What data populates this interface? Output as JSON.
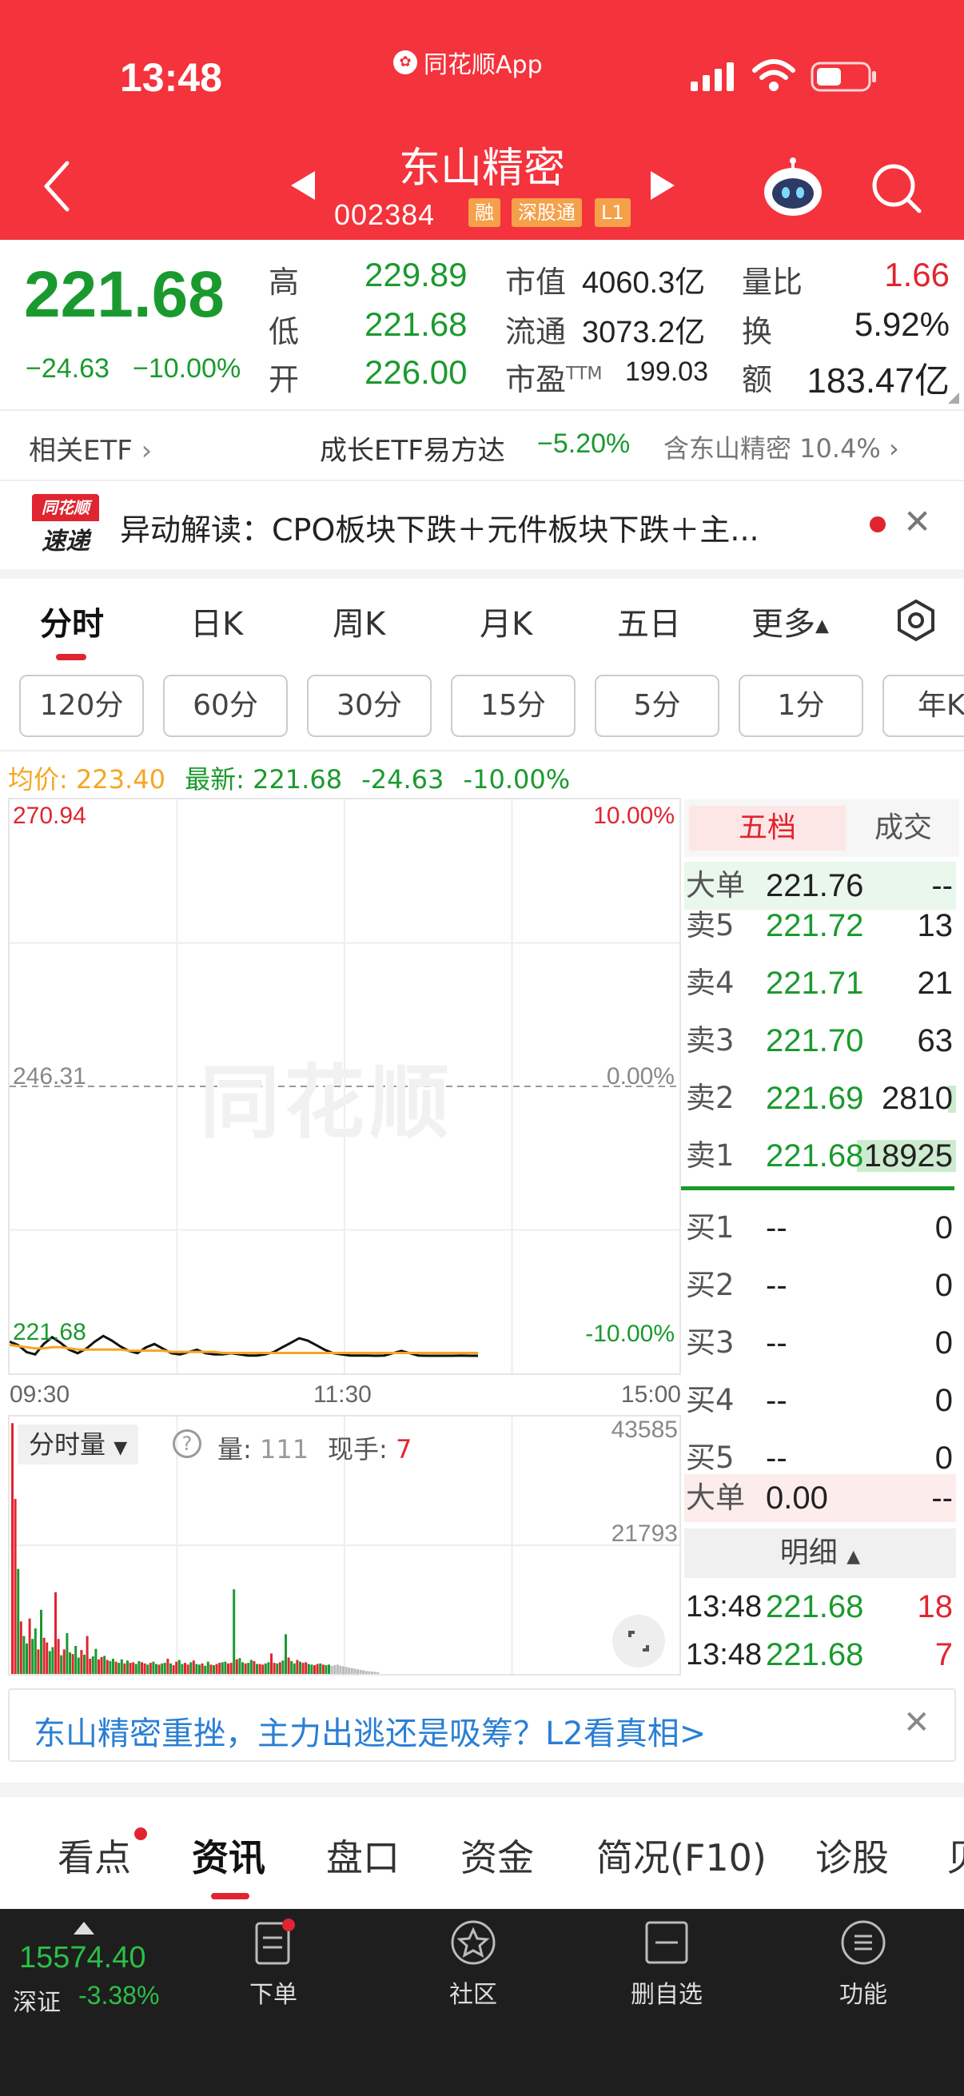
{
  "status_bar": {
    "time": "13:48",
    "app_label": "同花顺App"
  },
  "header": {
    "title": "东山精密",
    "code": "002384",
    "tags": [
      "融",
      "深股通",
      "L1"
    ],
    "icons": [
      "back-icon",
      "prev-stock-icon",
      "next-stock-icon",
      "robot-assistant-icon",
      "search-icon"
    ]
  },
  "quote": {
    "price": "221.68",
    "change": "−24.63",
    "change_pct": "−10.00%",
    "fields": [
      {
        "label": "高",
        "value": "229.89"
      },
      {
        "label": "低",
        "value": "221.68"
      },
      {
        "label": "开",
        "value": "226.00"
      }
    ],
    "fields2": [
      {
        "label": "市值",
        "value": "4060.3亿"
      },
      {
        "label": "流通",
        "value": "3073.2亿"
      },
      {
        "label": "市盈",
        "sup": "TTM",
        "value": "199.03"
      }
    ],
    "fields3": [
      {
        "label": "量比",
        "value": "1.66"
      },
      {
        "label": "换",
        "value": "5.92%"
      },
      {
        "label": "额",
        "value": "183.47亿"
      }
    ]
  },
  "etf": {
    "label": "相关ETF",
    "name": "成长ETF易方达",
    "change": "−5.20%",
    "holding": "含东山精密 10.4%"
  },
  "news_banner": {
    "badge_top": "同花顺",
    "badge_bottom": "速递",
    "text": "异动解读：CPO板块下跌＋元件板块下跌＋主..."
  },
  "chart_tabs": [
    "分时",
    "日K",
    "周K",
    "月K",
    "五日",
    "更多"
  ],
  "period_buttons": [
    "120分",
    "60分",
    "30分",
    "15分",
    "5分",
    "1分",
    "年K"
  ],
  "price_line": {
    "avg_label": "均价:",
    "avg": "223.40",
    "latest_label": "最新:",
    "latest": "221.68",
    "chg": "-24.63",
    "pct": "-10.00%"
  },
  "chart_data": {
    "type": "line",
    "y_top": "270.94",
    "y_mid": "246.31",
    "y_bottom": "221.68",
    "pct_top": "10.00%",
    "pct_mid": "0.00%",
    "pct_bottom": "-10.00%",
    "x_labels": [
      "09:30",
      "11:30",
      "15:00"
    ],
    "watermark": "同花顺",
    "ylim": [
      221.68,
      270.94
    ],
    "series": [
      {
        "values": [
          222.9,
          222.6,
          222.0,
          221.8,
          222.7,
          223.3,
          222.8,
          222.2,
          221.9,
          222.3,
          222.9,
          223.4,
          223.0,
          222.5,
          222.1,
          221.9,
          222.4,
          222.7,
          222.3,
          221.9,
          221.8,
          222.0,
          222.2,
          221.9,
          221.8,
          221.8,
          221.9,
          221.8,
          221.7,
          221.7,
          221.8,
          222.0,
          222.4,
          222.8,
          223.2,
          223.0,
          222.6,
          222.2,
          221.9,
          221.8,
          221.7,
          221.7,
          221.7,
          221.68,
          221.7,
          221.9,
          222.1,
          221.9,
          221.7,
          221.68,
          221.68,
          221.68,
          221.68,
          221.7,
          221.68,
          221.68
        ]
      },
      {
        "values": [
          222.9,
          222.8,
          222.7,
          222.6,
          222.6,
          222.7,
          222.7,
          222.6,
          222.5,
          222.5,
          222.5,
          222.5,
          222.5,
          222.5,
          222.4,
          222.4,
          222.4,
          222.4,
          222.4,
          222.3,
          222.3,
          222.3,
          222.3,
          222.3,
          222.3,
          222.2,
          222.2,
          222.2,
          222.2,
          222.2,
          222.2,
          222.2,
          222.2,
          222.2,
          222.2,
          222.2,
          222.2,
          222.2,
          222.2,
          222.2,
          222.2,
          222.2,
          222.2,
          222.2,
          222.2,
          222.2,
          222.2,
          222.2,
          222.2,
          222.2,
          222.2,
          222.2,
          222.2,
          222.2,
          222.2,
          222.2
        ]
      }
    ],
    "colors": {
      "price_line": "#111111",
      "avg_line": "#f5a623",
      "up": "#e02530",
      "down": "#1a9a2e"
    }
  },
  "volume": {
    "label": "分时量",
    "vol_label": "量:",
    "vol": "111",
    "hand_label": "现手:",
    "hand": "7",
    "y_top": "43585",
    "y_mid": "21793",
    "ylim": [
      0,
      43585
    ],
    "bars": [
      43000,
      30000,
      18000,
      9000,
      6500,
      5200,
      9500,
      6000,
      7800,
      4200,
      11000,
      6200,
      5400,
      3900,
      4600,
      14000,
      6000,
      3200,
      4200,
      7000,
      3700,
      3400,
      4800,
      2800,
      4100,
      3300,
      6500,
      2600,
      3000,
      4300,
      2500,
      2900,
      3100,
      2400,
      2200,
      2600,
      2100,
      1900,
      2500,
      1800,
      2300,
      1900,
      2000,
      1700,
      2200,
      2000,
      1800,
      1600,
      1900,
      2100,
      1700,
      1600,
      1800,
      1900,
      2600,
      1800,
      1500,
      2100,
      2400,
      1700,
      1900,
      1600,
      2000,
      2300,
      1700,
      1600,
      1800,
      1400,
      2100,
      1600,
      1500,
      1700,
      1900,
      2000,
      2100,
      1800,
      1900,
      14500,
      2500,
      2700,
      2000,
      1800,
      1900,
      2400,
      2200,
      1700,
      1700,
      1600,
      1800,
      2000,
      3500,
      1900,
      1800,
      2000,
      2300,
      6800,
      2800,
      2200,
      1800,
      2400,
      2100,
      1900,
      2000,
      1700,
      1600,
      1500,
      1700,
      1800,
      1600,
      1500,
      1600,
      1400,
      1500,
      1600,
      1400,
      1300,
      1200,
      1100,
      1000,
      900,
      800,
      700,
      600,
      500,
      450,
      400,
      350,
      300
    ]
  },
  "orderbook": {
    "tabs": [
      "五档",
      "成交"
    ],
    "big_sell": {
      "label": "大单",
      "price": "221.76",
      "vol": "--"
    },
    "asks": [
      {
        "label": "卖5",
        "price": "221.72",
        "vol": "13"
      },
      {
        "label": "卖4",
        "price": "221.71",
        "vol": "21"
      },
      {
        "label": "卖3",
        "price": "221.70",
        "vol": "63"
      },
      {
        "label": "卖2",
        "price": "221.69",
        "vol": "2810"
      },
      {
        "label": "卖1",
        "price": "221.68",
        "vol": "18925"
      }
    ],
    "bids": [
      {
        "label": "买1",
        "price": "--",
        "vol": "0"
      },
      {
        "label": "买2",
        "price": "--",
        "vol": "0"
      },
      {
        "label": "买3",
        "price": "--",
        "vol": "0"
      },
      {
        "label": "买4",
        "price": "--",
        "vol": "0"
      },
      {
        "label": "买5",
        "price": "--",
        "vol": "0"
      }
    ],
    "big_buy": {
      "label": "大单",
      "price": "0.00",
      "vol": "--"
    },
    "detail_label": "明细",
    "ticks": [
      {
        "time": "13:48",
        "price": "221.68",
        "vol": "18"
      },
      {
        "time": "13:48",
        "price": "221.68",
        "vol": "7"
      }
    ]
  },
  "promo": {
    "text": "东山精密重挫，主力出逃还是吸筹？L2看真相>"
  },
  "news_tabs": [
    "看点",
    "资讯",
    "盘口",
    "资金",
    "简况(F10)",
    "诊股",
    "贝"
  ],
  "bottom_bar": {
    "index_value": "15574.40",
    "index_name": "深证",
    "index_change": "-3.38%",
    "items": [
      {
        "label": "下单",
        "icon": "order-icon"
      },
      {
        "label": "社区",
        "icon": "community-icon"
      },
      {
        "label": "删自选",
        "icon": "remove-watchlist-icon"
      },
      {
        "label": "功能",
        "icon": "menu-icon"
      }
    ]
  }
}
